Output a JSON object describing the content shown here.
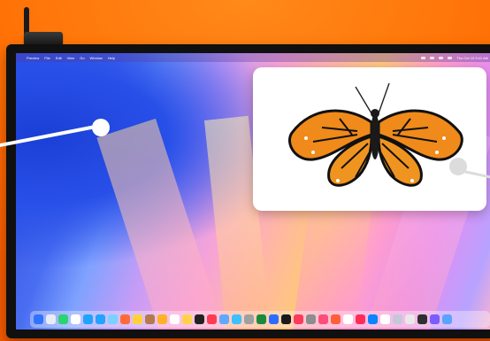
{
  "menubar": {
    "apple": "",
    "items": [
      "Preview",
      "File",
      "Edit",
      "View",
      "Go",
      "Window",
      "Help"
    ],
    "clock": "Thu Oct 10 9:41 AM"
  },
  "popup": {
    "image_subject": "monarch-butterfly"
  },
  "dock": {
    "colors": [
      "#2f73ff",
      "#e9ecf5",
      "#2bd46e",
      "#ffffff",
      "#1fa3ff",
      "#23a2ff",
      "#7ad1ff",
      "#ff6a3a",
      "#ffd23a",
      "#b37a52",
      "#ffb129",
      "#ffffff",
      "#ffd24a",
      "#222222",
      "#ff3b52",
      "#5fa8ff",
      "#3ec0ff",
      "#a0a0a0",
      "#1c8a3c",
      "#2b6cff",
      "#1a1a1a",
      "#ff3a5a",
      "#8d8d8d",
      "#ff4d7a",
      "#ff5e3a",
      "#ffffff",
      "#ff2d55",
      "#0a84ff",
      "#ffffff",
      "#c5c8d8",
      "#e9e9e9",
      "#2f2f2f",
      "#7b5cff",
      "#5aa3ff"
    ]
  },
  "colors": {
    "background": "#ff6a00",
    "popup": "#ffffff",
    "pointer": "#ffffff"
  }
}
